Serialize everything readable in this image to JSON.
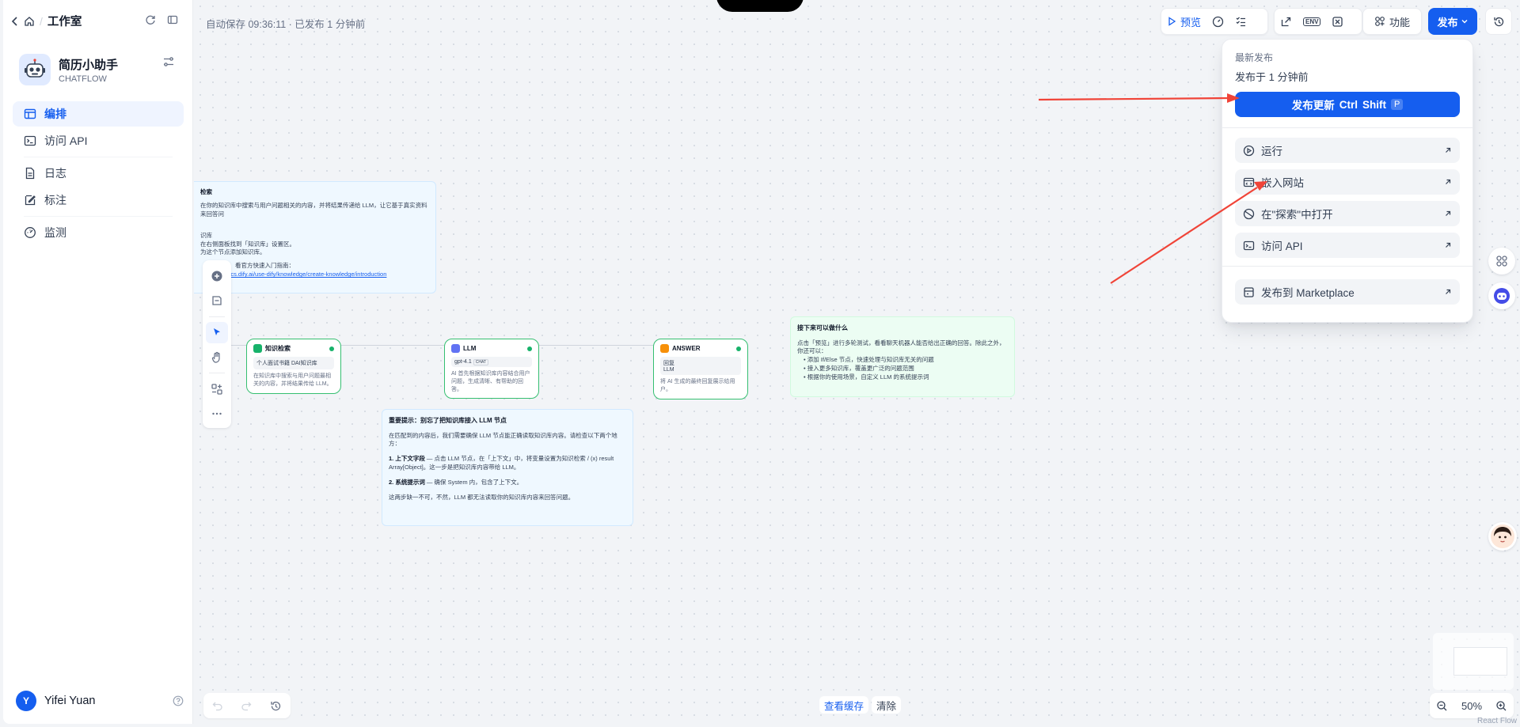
{
  "breadcrumb": {
    "title": "工作室"
  },
  "app": {
    "name": "简历小助手",
    "mode": "CHATFLOW"
  },
  "nav": [
    {
      "label": "编排",
      "icon": "layout-icon",
      "active": true
    },
    {
      "label": "访问 API",
      "icon": "terminal-icon"
    },
    {
      "label": "日志",
      "icon": "file-text-icon"
    },
    {
      "label": "标注",
      "icon": "annotation-icon"
    },
    {
      "label": "监测",
      "icon": "monitor-icon"
    }
  ],
  "user": {
    "initial": "Y",
    "name": "Yifei Yuan"
  },
  "header": {
    "autosave": "自动保存 09:36:11 · 已发布 1 分钟前",
    "preview": "预览",
    "features": "功能",
    "publish": "发布"
  },
  "publish_panel": {
    "latest": "最新发布",
    "published_at": "发布于 1 分钟前",
    "update_button": "发布更新",
    "shortcut": [
      "Ctrl",
      "Shift",
      "P"
    ],
    "items": [
      "运行",
      "嵌入网站",
      "在\"探索\"中打开",
      "访问 API"
    ],
    "marketplace": "发布到 Marketplace"
  },
  "nodes": {
    "knowledge": {
      "title": "知识检索",
      "box": "个人面试书籍 DAI知识库",
      "desc": "在知识库中搜索与用户问题最相关的内容，并将结果传给 LLM。"
    },
    "llm": {
      "title": "LLM",
      "model": "gpt-4.1",
      "tag": "CHAT",
      "desc": "AI 首先根据知识库内容结合用户问题，生成清晰、有帮助的回答。"
    },
    "answer": {
      "title": "ANSWER",
      "box_label": "回复",
      "box_value": "LLM",
      "desc": "将 AI 生成的最终回复展示给用户。"
    }
  },
  "notes": {
    "top_left": {
      "title": "检索",
      "line1": "在你的知识库中搜索与用户问题相关的内容，并将结果传递给 LLM，让它基于真实资料来回答问",
      "h2": "识库",
      "l2": "在右侧面板找到「知识库」设置区。",
      "l3": "为这个节点添加知识库。",
      "l4": "看官方快速入门指南：",
      "link": "docs.dify.ai/use-dify/knowledge/create-knowledge/introduction"
    },
    "bottom": {
      "title": "重要提示：别忘了把知识库接入 LLM 节点",
      "p1": "在匹配到的内容后，我们需要确保 LLM 节点能正确读取知识库内容。请检查以下两个地方：",
      "p2a": "1. 上下文字段",
      "p2b": " — 点击 LLM 节点，在「上下文」中，将变量设置为知识检索 / (x) result Array[Object]。这一步是把知识库内容带给 LLM。",
      "p3a": "2. 系统提示词",
      "p3b": " — 确保 System 内，包含了上下文。",
      "p4": "这两步缺一不可，不然，LLM 都无法读取你的知识库内容来回答问题。"
    },
    "right": {
      "title": "接下来可以做什么",
      "p1": "点击「预览」进行多轮测试，看看聊天机器人能否给出正确的回答。除此之外，你还可以：",
      "b1": "添加 If/Else 节点，快速处理与知识库无关的问题",
      "b2": "接入更多知识库，覆盖更广泛的问题范围",
      "b3": "根据你的使用场景，自定义 LLM 的系统提示词"
    }
  },
  "bottom": {
    "view_cache": "查看缓存",
    "clear": "清除",
    "zoom": "50%"
  },
  "footer_credit": "React Flow",
  "colors": {
    "accent": "#155eef",
    "node_border": "#36bf71",
    "arrow": "#f04438"
  }
}
